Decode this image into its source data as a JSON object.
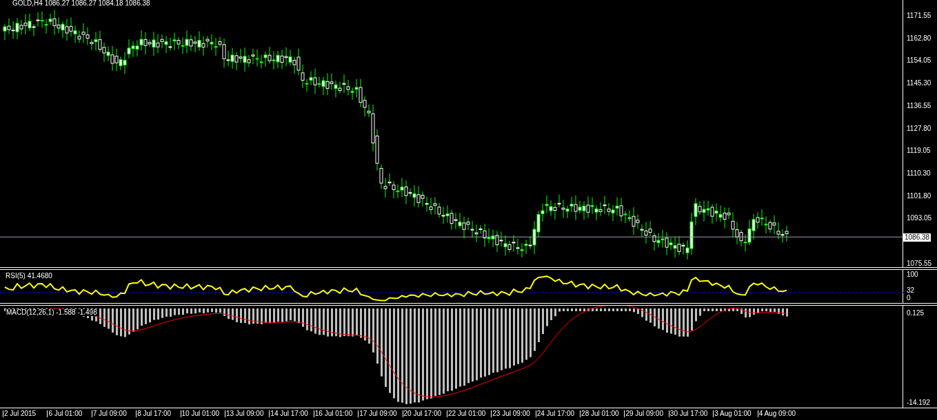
{
  "header": {
    "title": "GOLD,H4  1086.27 1086.27 1084.18 1086.38"
  },
  "price_axis": {
    "labels": [
      "1171.55",
      "1162.80",
      "1154.05",
      "1145.30",
      "1136.55",
      "1127.80",
      "1119.05",
      "1110.30",
      "1101.80",
      "1093.05",
      "1075.55"
    ],
    "current": "1086.38"
  },
  "rsi": {
    "title": "RSI(5) 41.4680",
    "labels": [
      "100",
      "32",
      "0"
    ]
  },
  "macd": {
    "title": "MACD(12,26,1) -1.588 -1.498",
    "labels": [
      "0.125",
      "-14.192"
    ]
  },
  "time_axis": {
    "labels": [
      "2 Jul 2015",
      "6 Jul 01:00",
      "7 Jul 09:00",
      "8 Jul 17:00",
      "10 Jul 01:00",
      "13 Jul 09:00",
      "14 Jul 17:00",
      "16 Jul 01:00",
      "17 Jul 09:00",
      "20 Jul 17:00",
      "22 Jul 01:00",
      "23 Jul 09:00",
      "24 Jul 17:00",
      "28 Jul 01:00",
      "29 Jul 09:00",
      "30 Jul 17:00",
      "3 Aug 01:00",
      "4 Aug 09:00"
    ]
  }
}
